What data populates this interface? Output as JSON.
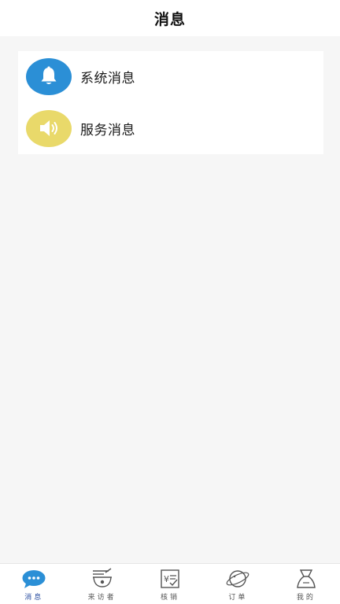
{
  "header": {
    "title": "消息"
  },
  "messages": [
    {
      "label": "系统消息",
      "icon": "bell-icon",
      "icon_bg": "#2b8fd6"
    },
    {
      "label": "服务消息",
      "icon": "speaker-icon",
      "icon_bg": "#e9d96a"
    }
  ],
  "tabbar": {
    "active_color": "#2b8fd6",
    "tabs": [
      {
        "label": "消息",
        "icon": "chat-bubble-icon",
        "active": true
      },
      {
        "label": "来访者",
        "icon": "visitor-icon",
        "active": false
      },
      {
        "label": "核销",
        "icon": "voucher-icon",
        "active": false
      },
      {
        "label": "订单",
        "icon": "planet-icon",
        "active": false
      },
      {
        "label": "我的",
        "icon": "profile-icon",
        "active": false
      }
    ]
  }
}
